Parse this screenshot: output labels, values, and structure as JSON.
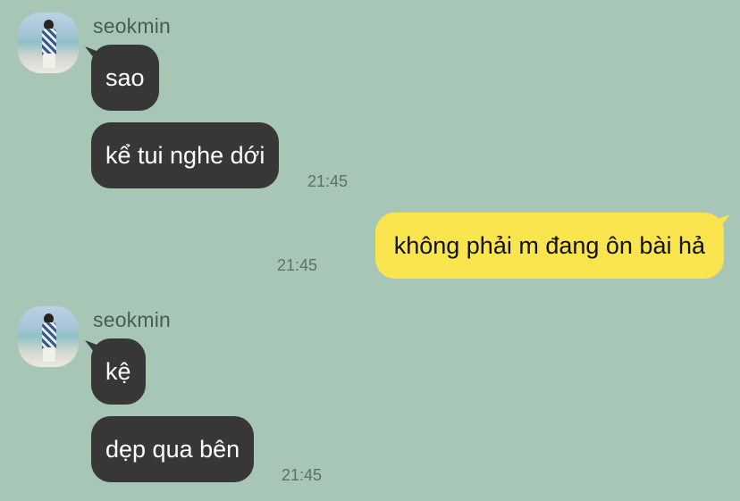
{
  "colors": {
    "background": "#a8c6b5",
    "incoming_bubble": "#373737",
    "outgoing_bubble": "#fae54e",
    "timestamp": "#5f6f67"
  },
  "groups": [
    {
      "sender": "seokmin",
      "avatar_icon": "avatar-photo",
      "messages": [
        {
          "text": "sao"
        },
        {
          "text": "kể tui nghe dới",
          "time": "21:45"
        }
      ]
    },
    {
      "outgoing": true,
      "messages": [
        {
          "text": "không phải m đang ôn bài hả",
          "time": "21:45"
        }
      ]
    },
    {
      "sender": "seokmin",
      "avatar_icon": "avatar-photo",
      "messages": [
        {
          "text": "kệ"
        },
        {
          "text": "dẹp qua bên",
          "time": "21:45"
        }
      ]
    }
  ]
}
